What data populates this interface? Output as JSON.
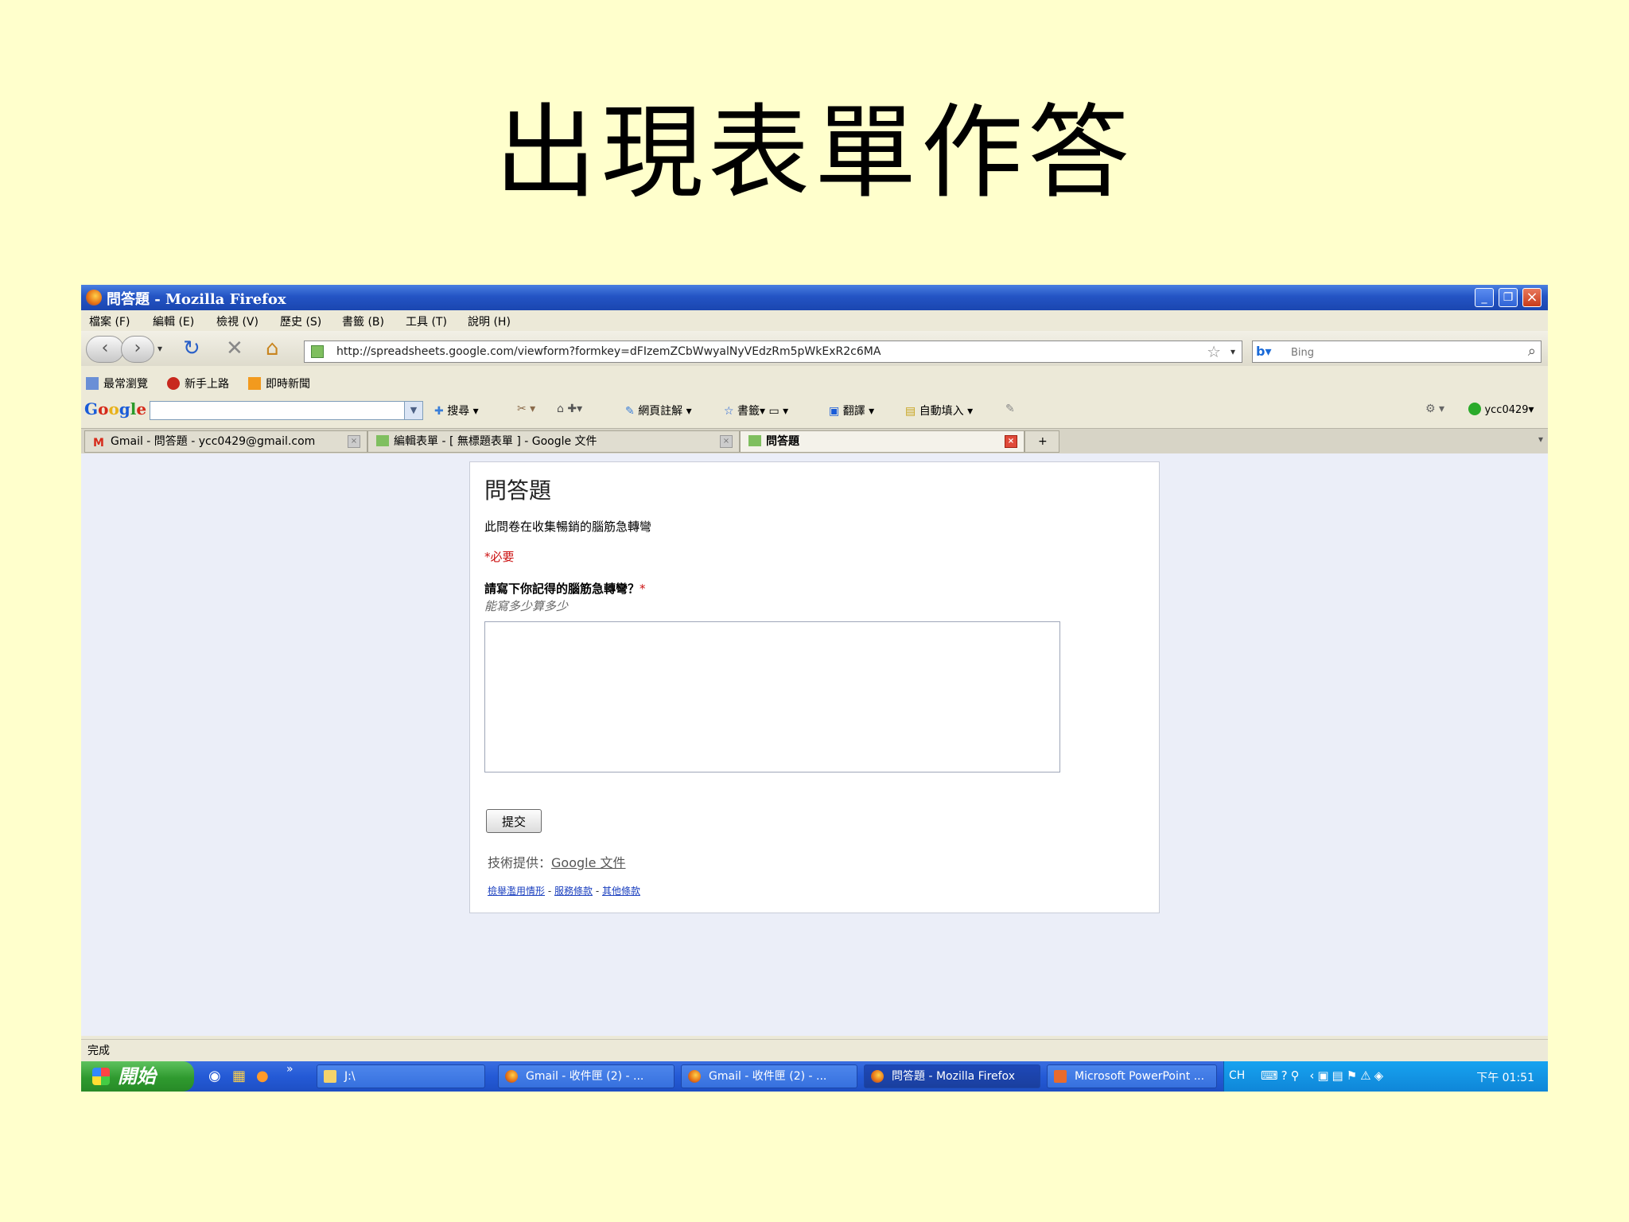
{
  "slide": {
    "title": "出現表單作答"
  },
  "window": {
    "title": "問答題 - Mozilla Firefox"
  },
  "menu": [
    "檔案 (F)",
    "編輯 (E)",
    "檢視 (V)",
    "歷史 (S)",
    "書籤 (B)",
    "工具 (T)",
    "說明 (H)"
  ],
  "nav": {
    "url": "http://spreadsheets.google.com/viewform?formkey=dFIzemZCbWwyalNyVEdzRm5pWkExR2c6MA",
    "search_placeholder": "Bing"
  },
  "bookmarks": [
    "最常瀏覽",
    "新手上路",
    "即時新聞"
  ],
  "google_toolbar": {
    "logo": "Google",
    "search": "搜尋",
    "annotate": "網頁註解",
    "bookmarks": "書籤",
    "translate": "翻譯",
    "autofill": "自動填入",
    "account": "ycc0429"
  },
  "tabs": [
    {
      "label": "Gmail - 問答題 - ycc0429@gmail.com"
    },
    {
      "label": "編輯表單 - [ 無標題表單 ] - Google 文件"
    },
    {
      "label": "問答題"
    }
  ],
  "form": {
    "title": "問答題",
    "description": "此問卷在收集暢銷的腦筋急轉彎",
    "required_note": "*必要",
    "question": "請寫下你記得的腦筋急轉彎？",
    "required_star": "*",
    "hint": "能寫多少算多少",
    "answer": "",
    "submit": "提交",
    "powered_prefix": "技術提供：",
    "powered_link": "Google 文件",
    "footer_links": [
      "檢舉濫用情形",
      "服務條款",
      "其他條款"
    ],
    "footer_sep": " - "
  },
  "status": {
    "text": "完成"
  },
  "taskbar": {
    "start": "開始",
    "items": [
      {
        "label": "J:\\"
      },
      {
        "label": "Gmail - 收件匣 (2) - ..."
      },
      {
        "label": "Gmail - 收件匣 (2) - ..."
      },
      {
        "label": "問答題 - Mozilla Firefox"
      },
      {
        "label": "Microsoft PowerPoint ..."
      }
    ],
    "lang": "CH",
    "time": "下午 01:51"
  }
}
